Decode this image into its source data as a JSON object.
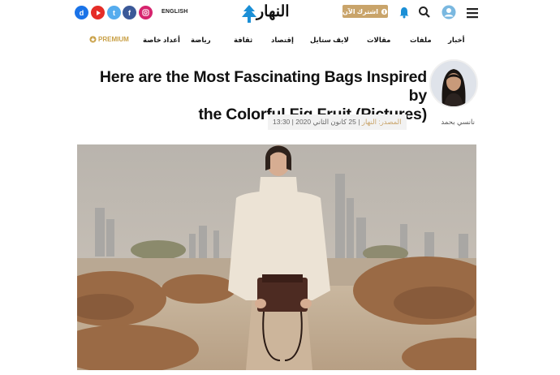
{
  "header": {
    "social": [
      {
        "name": "dailymotion",
        "glyph": "d",
        "color": "#1a73e8"
      },
      {
        "name": "youtube",
        "glyph": "▶",
        "color": "#e52d27"
      },
      {
        "name": "twitter",
        "glyph": "t",
        "color": "#55acee"
      },
      {
        "name": "facebook",
        "glyph": "f",
        "color": "#3b5998"
      },
      {
        "name": "instagram",
        "glyph": "◎",
        "color": "#d6246e"
      }
    ],
    "language_label": "ENGLISH",
    "logo_text": "النهار",
    "subscribe_label": "اشترك الآن",
    "icons": [
      "search-icon",
      "bell-icon",
      "user-icon",
      "menu-icon"
    ]
  },
  "nav": {
    "items": [
      "أخبار",
      "ملفات",
      "مقالات",
      "لايف ستايل",
      "إقتصاد",
      "ثقافة",
      "رياضة",
      "أعداد خاصة"
    ],
    "premium_label": "PREMIUM"
  },
  "article": {
    "title_line1": "Here are the Most Fascinating Bags Inspired by",
    "title_line2": "the Colorful Fig Fruit (Pictures)",
    "author": "نانسي بحمد",
    "source": "المصدر: النهار",
    "date": "25 كانون الثاني 2020 | 13:30"
  },
  "colors": {
    "accent": "#c9a46a",
    "premium": "#c9a046"
  }
}
